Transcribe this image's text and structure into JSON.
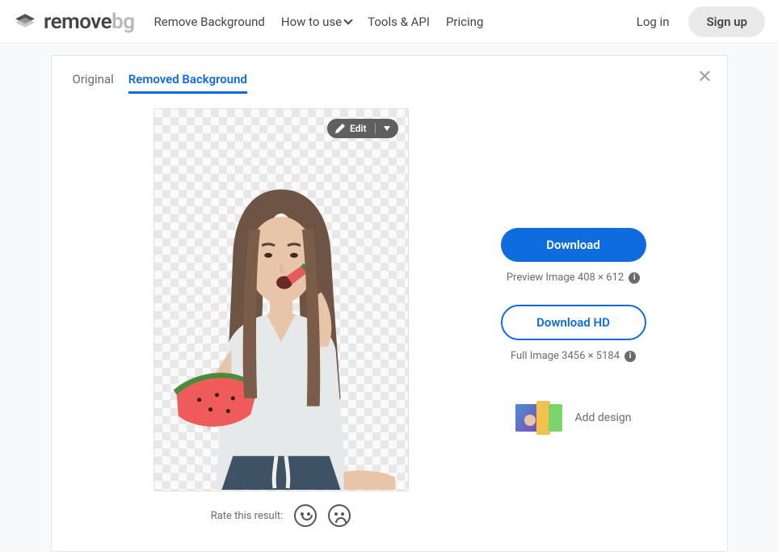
{
  "header": {
    "logo_prefix": "remove",
    "logo_suffix": "bg",
    "nav": {
      "remove_bg": "Remove Background",
      "how_to_use": "How to use",
      "tools_api": "Tools & API",
      "pricing": "Pricing"
    },
    "login": "Log in",
    "signup": "Sign up"
  },
  "editor": {
    "tabs": {
      "original": "Original",
      "removed": "Removed Background"
    },
    "edit_button": "Edit",
    "rate_label": "Rate this result:"
  },
  "download": {
    "primary": "Download",
    "preview_meta": "Preview Image 408 × 612",
    "hd": "Download HD",
    "full_meta": "Full Image 3456 × 5184",
    "add_design": "Add design"
  }
}
